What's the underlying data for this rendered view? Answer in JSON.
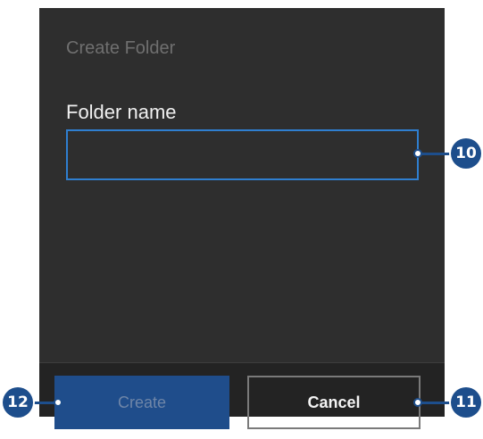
{
  "dialog": {
    "title": "Create Folder",
    "field_label": "Folder name",
    "input_value": "",
    "input_placeholder": ""
  },
  "buttons": {
    "create_label": "Create",
    "cancel_label": "Cancel"
  },
  "callouts": {
    "input": "10",
    "cancel": "11",
    "create": "12"
  },
  "colors": {
    "dialog_bg": "#2e2e2e",
    "accent": "#2f7fd0",
    "primary_button": "#1f4d8b",
    "callout": "#1d4e8c"
  }
}
